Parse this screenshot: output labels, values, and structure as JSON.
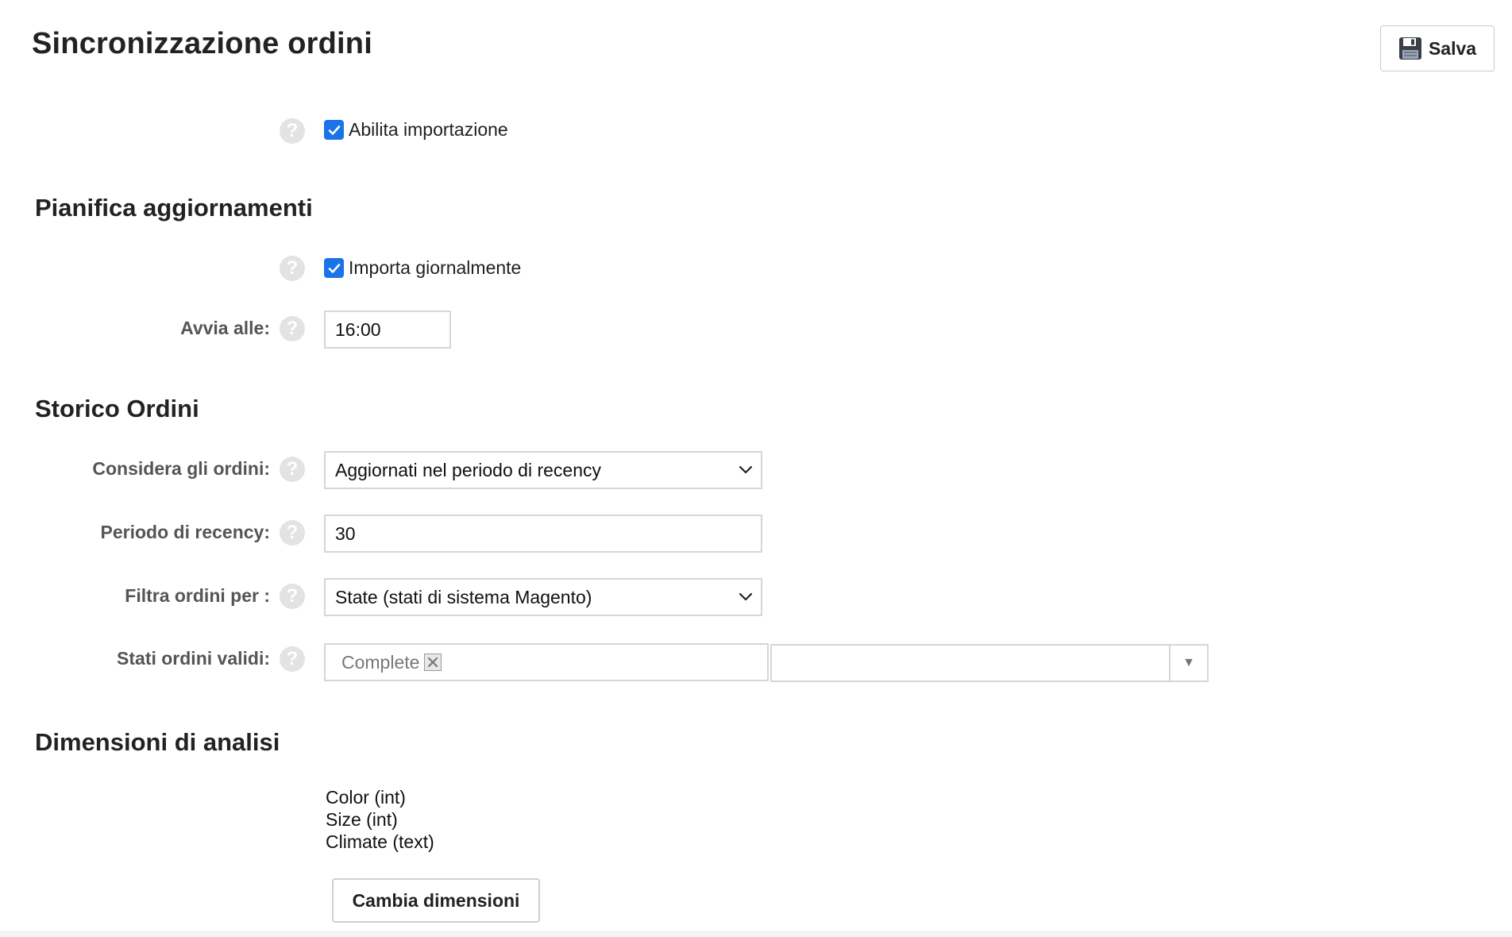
{
  "header": {
    "title": "Sincronizzazione ordini",
    "save_label": "Salva"
  },
  "import": {
    "enable_label": "Abilita importazione",
    "enabled": true
  },
  "schedule": {
    "heading": "Pianifica aggiornamenti",
    "daily_label": "Importa giornalmente",
    "daily_enabled": true,
    "start_label": "Avvia alle:",
    "start_value": "16:00"
  },
  "history": {
    "heading": "Storico Ordini",
    "consider_label": "Considera gli ordini:",
    "consider_value": "Aggiornati nel periodo di recency",
    "recency_label": "Periodo di recency:",
    "recency_value": "30",
    "filter_label": "Filtra ordini per :",
    "filter_value": "State (stati di sistema Magento)",
    "valid_states_label": "Stati ordini validi:",
    "valid_states": [
      "Complete"
    ]
  },
  "dimensions": {
    "heading": "Dimensioni di analisi",
    "items": [
      "Color (int)",
      "Size (int)",
      "Climate (text)"
    ],
    "change_label": "Cambia dimensioni"
  },
  "colors": {
    "accent": "#1a73e8",
    "help_icon": "#e3e3e3",
    "border": "#d6d6d6"
  },
  "icons": {
    "save": "floppy-disk-icon",
    "help": "question-mark-icon",
    "dropdown": "chevron-down-icon",
    "tag_remove": "close-icon"
  }
}
